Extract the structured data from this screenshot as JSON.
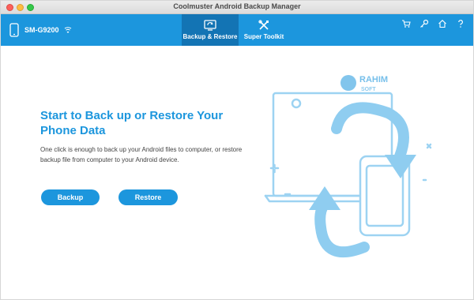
{
  "window": {
    "title": "Coolmuster Android Backup Manager"
  },
  "header": {
    "device_name": "SM-G9200",
    "tabs": [
      {
        "label": "Backup & Restore",
        "icon": "backup-restore-icon",
        "active": true
      },
      {
        "label": "Super Toolkit",
        "icon": "toolkit-icon",
        "active": false
      }
    ],
    "icons": [
      "cart-icon",
      "key-icon",
      "home-icon",
      "help-icon"
    ]
  },
  "main": {
    "headline": "Start to Back up or Restore Your Phone Data",
    "description": "One click is enough to back up your Android files to computer, or restore backup file from computer to your Android device.",
    "backup_label": "Backup",
    "restore_label": "Restore"
  },
  "watermark": {
    "line1": "RAHIM",
    "line2": "SOFT"
  },
  "colors": {
    "accent": "#1c96dd",
    "accent_dark": "#1374b4",
    "illustration": "#8fcdf0"
  }
}
